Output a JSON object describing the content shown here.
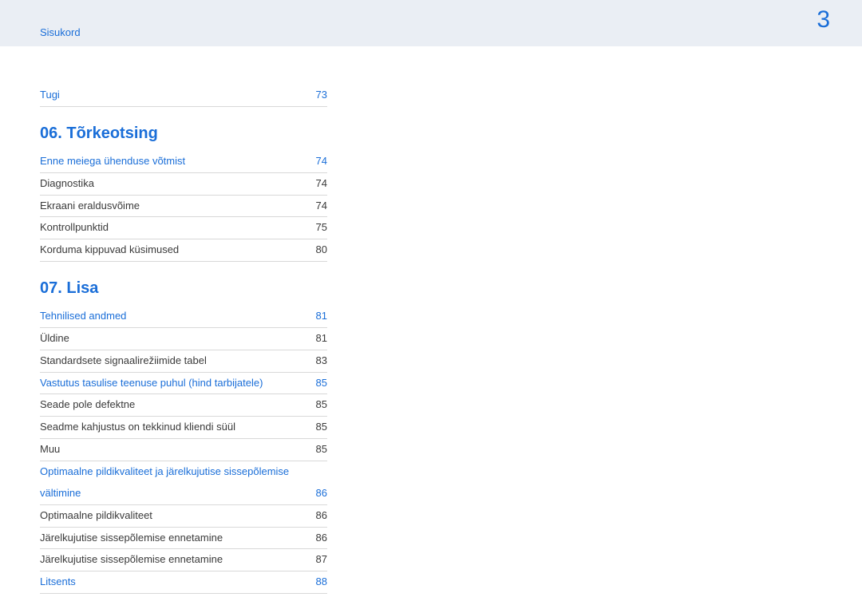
{
  "header": {
    "link": "Sisukord",
    "pageNumber": "3"
  },
  "blocks": [
    {
      "type": "row",
      "style": "link",
      "label": "Tugi",
      "page": "73"
    },
    {
      "type": "title",
      "text": "06. Tõrkeotsing"
    },
    {
      "type": "row",
      "style": "link",
      "label": "Enne meiega ühenduse võtmist",
      "page": "74"
    },
    {
      "type": "row",
      "style": "plain",
      "label": "Diagnostika",
      "page": "74"
    },
    {
      "type": "row",
      "style": "plain",
      "label": "Ekraani eraldusvõime",
      "page": "74"
    },
    {
      "type": "row",
      "style": "plain",
      "label": "Kontrollpunktid",
      "page": "75"
    },
    {
      "type": "row",
      "style": "plain",
      "label": "Korduma kippuvad küsimused",
      "page": "80"
    },
    {
      "type": "title",
      "text": "07.  Lisa"
    },
    {
      "type": "row",
      "style": "link",
      "label": "Tehnilised andmed",
      "page": "81"
    },
    {
      "type": "row",
      "style": "plain",
      "label": "Üldine",
      "page": "81"
    },
    {
      "type": "row",
      "style": "plain",
      "label": "Standardsete signaalirežiimide tabel",
      "page": "83"
    },
    {
      "type": "row",
      "style": "link",
      "label": "Vastutus tasulise teenuse puhul (hind tarbijatele)",
      "page": "85"
    },
    {
      "type": "row",
      "style": "plain",
      "label": "Seade pole defektne",
      "page": "85"
    },
    {
      "type": "row",
      "style": "plain",
      "label": "Seadme kahjustus on tekkinud kliendi süül",
      "page": "85"
    },
    {
      "type": "row",
      "style": "plain",
      "label": "Muu",
      "page": "85"
    },
    {
      "type": "row",
      "style": "link",
      "noborder": true,
      "label": "Optimaalne pildikvaliteet ja järelkujutise sissepõlemise",
      "page": ""
    },
    {
      "type": "row",
      "style": "link",
      "label": "vältimine",
      "page": "86"
    },
    {
      "type": "row",
      "style": "plain",
      "label": "Optimaalne pildikvaliteet",
      "page": "86"
    },
    {
      "type": "row",
      "style": "plain",
      "label": "Järelkujutise sissepõlemise ennetamine",
      "page": "86"
    },
    {
      "type": "row",
      "style": "plain",
      "label": "Järelkujutise sissepõlemise ennetamine",
      "page": "87"
    },
    {
      "type": "row",
      "style": "link",
      "label": "Litsents",
      "page": "88"
    }
  ]
}
